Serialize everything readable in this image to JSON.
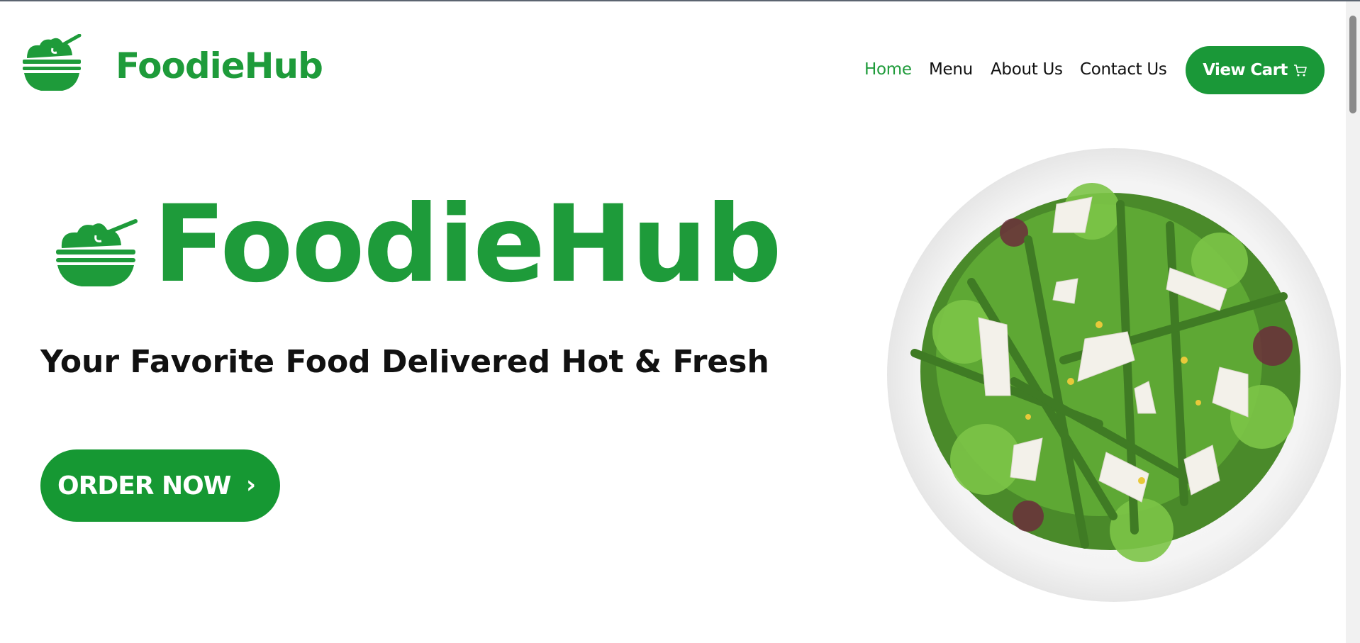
{
  "brand": {
    "name": "FoodieHub",
    "color": "#1e9b3a"
  },
  "nav": {
    "items": [
      {
        "label": "Home",
        "active": true
      },
      {
        "label": "Menu",
        "active": false
      },
      {
        "label": "About Us",
        "active": false
      },
      {
        "label": "Contact Us",
        "active": false
      }
    ],
    "cart_label": "View Cart",
    "cart_icon": "cart-icon"
  },
  "hero": {
    "title": "FoodieHub",
    "subtitle": "Your Favorite Food Delivered Hot & Fresh",
    "cta_label": "ORDER NOW",
    "cta_icon": "chevron-right-icon",
    "image": "salad-plate-image"
  },
  "colors": {
    "accent": "#1a9838",
    "text": "#111111",
    "background": "#ffffff"
  }
}
